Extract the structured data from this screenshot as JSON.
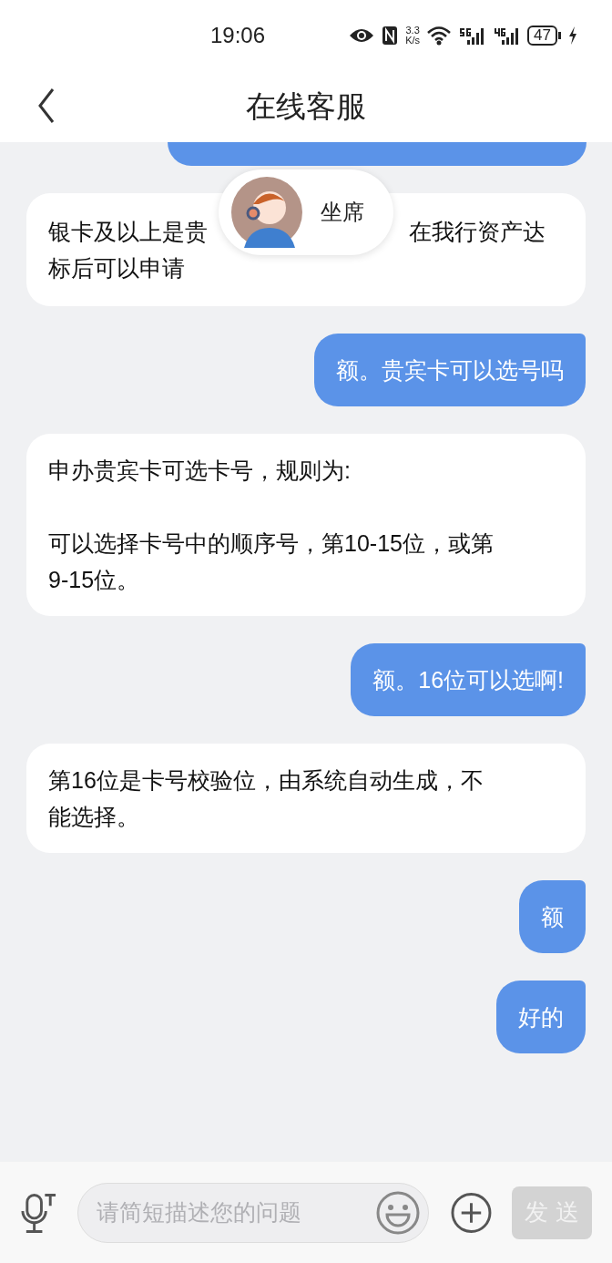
{
  "status_bar": {
    "time": "19:06",
    "speed_value": "3.3",
    "speed_unit": "K/s",
    "battery": "47"
  },
  "header": {
    "title": "在线客服"
  },
  "agent_badge": {
    "label": "坐席"
  },
  "messages": [
    {
      "from_me": true,
      "kind": "cut_off"
    },
    {
      "from_me": false,
      "kind": "partly_covered",
      "lines": [
        [
          "银卡及以上是贵",
          "在我行资产达"
        ],
        [
          "标后可以申请"
        ]
      ]
    },
    {
      "from_me": true,
      "kind": "text",
      "text": "额。贵宾卡可以选号吗"
    },
    {
      "from_me": false,
      "kind": "text",
      "text": "申办贵宾卡可选卡号，规则为:\n\n可以选择卡号中的顺序号，第10-15位，或第9-15位。"
    },
    {
      "from_me": true,
      "kind": "text",
      "text": "额。16位可以选啊!"
    },
    {
      "from_me": false,
      "kind": "text",
      "text": "第16位是卡号校验位，由系统自动生成，不能选择。"
    },
    {
      "from_me": true,
      "kind": "text",
      "text": "额"
    },
    {
      "from_me": true,
      "kind": "text",
      "text": "好的"
    }
  ],
  "input_bar": {
    "placeholder": "请简短描述您的问题",
    "send_label": "发送",
    "send_disabled": true
  }
}
